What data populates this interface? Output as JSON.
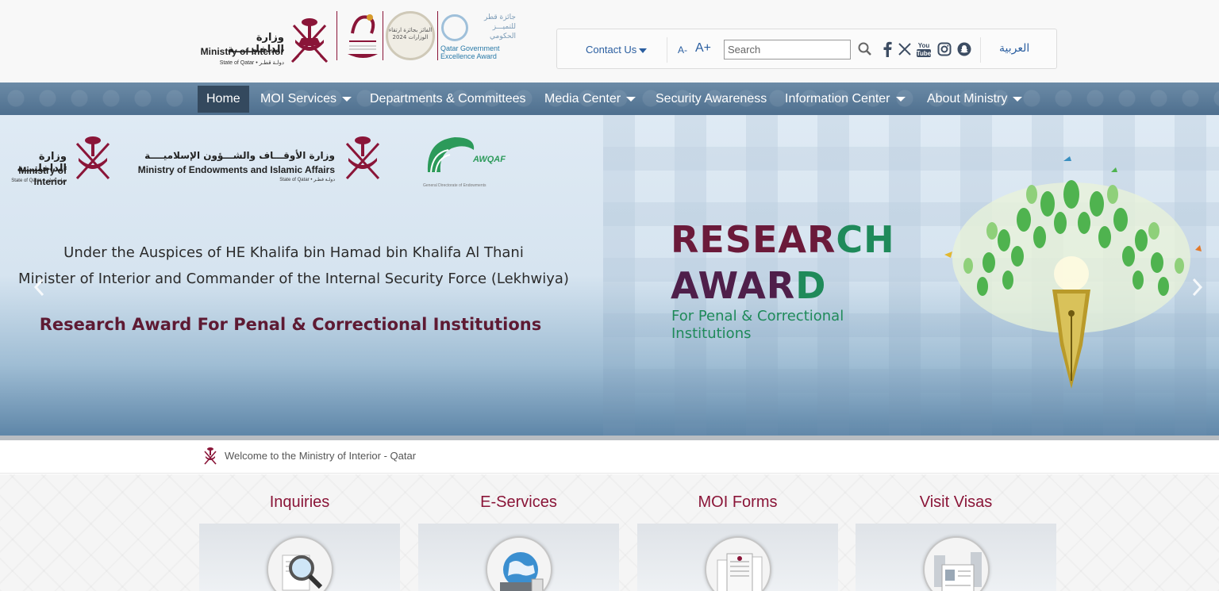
{
  "header": {
    "moi_logo": {
      "arabic": "وزارة الداخليـــــة",
      "english": "Ministry of Interior",
      "subtitle": "State of Qatar • دولـة قطـر"
    },
    "excellence_award": {
      "arabic_line1": "جائزة قطر",
      "arabic_line2": "للتميـــز",
      "arabic_line3": "الحكومي",
      "english": "Qatar Government Excellence Award"
    },
    "badge_text": "الفائز بجائزة ارتقاء الوزارات 2024"
  },
  "toolbar": {
    "contact_label": "Contact Us",
    "font_decrease": "A-",
    "font_increase": "A+",
    "search_placeholder": "Search",
    "language_label": "العربية",
    "social_icons": [
      "facebook-icon",
      "x-icon",
      "youtube-icon",
      "instagram-icon",
      "snapchat-icon"
    ]
  },
  "nav": {
    "items": [
      {
        "label": "Home",
        "active": true,
        "dropdown": false
      },
      {
        "label": "MOI Services",
        "dropdown": true
      },
      {
        "label": "Departments & Committees",
        "dropdown": false
      },
      {
        "label": "Media Center",
        "dropdown": true
      },
      {
        "label": "Security Awareness",
        "dropdown": false
      },
      {
        "label": "Information Center",
        "dropdown": true
      },
      {
        "label": "About Ministry",
        "dropdown": true
      }
    ]
  },
  "banner": {
    "logo1_arabic": "وزارة الداخليـــة",
    "logo1_english": "Ministry of Interior",
    "logo1_sub": "State of Qatar • دولـة قطـر",
    "logo2_arabic": "وزارة الأوقـــاف والشـــؤون الإسلاميــــة",
    "logo2_english": "Ministry of Endowments and Islamic Affairs",
    "logo2_sub": "State of Qatar • دولـة قطـر",
    "awqaf_label": "AWQAF",
    "awqaf_sub": "General Directorate of Endowments",
    "auspices": "Under the Auspices of HE Khalifa bin Hamad bin Khalifa Al Thani",
    "minister": "Minister of Interior and Commander of the Internal Security Force (Lekhwiya)",
    "award_line": "Research Award For Penal & Correctional Institutions",
    "research_word_a": "RESEAR",
    "research_word_b": "CH",
    "award_word_a": "AWAR",
    "award_word_b": "D",
    "for_line1": "For Penal & Correctional",
    "for_line2": "Institutions"
  },
  "welcome": {
    "text": "Welcome to the Ministry of Interior - Qatar"
  },
  "cards": [
    {
      "title": "Inquiries",
      "icon": "magnifier-document-icon"
    },
    {
      "title": "E-Services",
      "icon": "globe-laptop-icon"
    },
    {
      "title": "MOI Forms",
      "icon": "forms-document-icon"
    },
    {
      "title": "Visit Visas",
      "icon": "visa-document-icon"
    }
  ],
  "colors": {
    "brand_maroon": "#8a1538",
    "nav_blue": "#5a7b9a",
    "link_blue": "#2a5ea0",
    "award_green": "#1f8a5a"
  }
}
